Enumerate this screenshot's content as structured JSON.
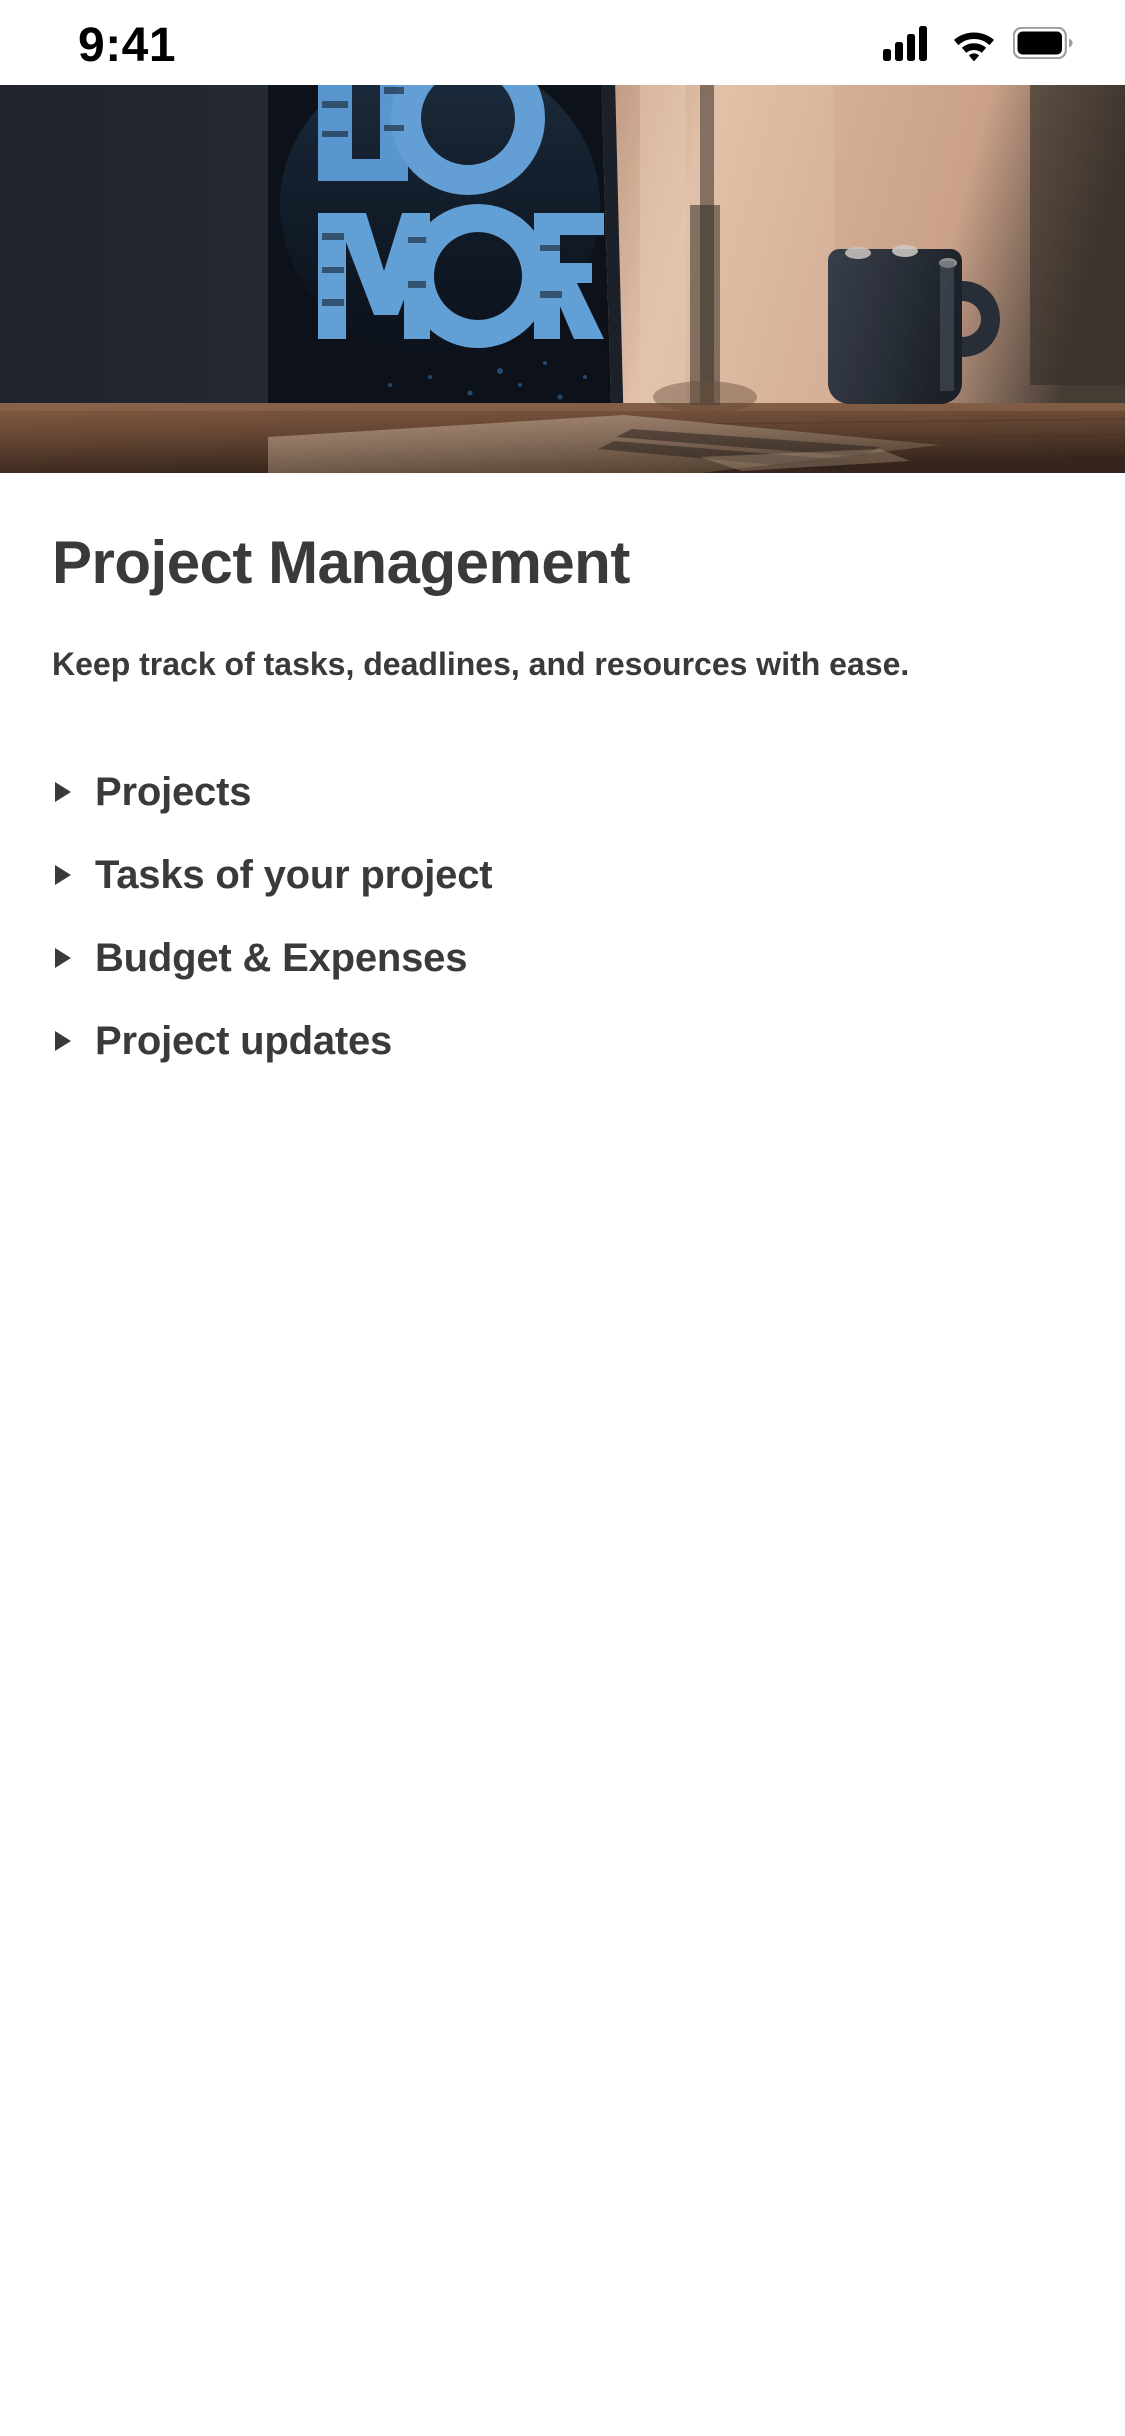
{
  "status_bar": {
    "time": "9:41",
    "icons": {
      "cellular": "cellular-signal-icon",
      "wifi": "wifi-icon",
      "battery": "battery-full-icon"
    }
  },
  "hero": {
    "alt": "laptop-on-desk-photo",
    "screen_text_line1": "DO",
    "screen_text_line2": "MORE.",
    "colors": {
      "wall_dark": "#2b313b",
      "screen_dark": "#10151d",
      "screen_glyph_blue": "#4b8fd4",
      "warm_light": "#e2b79b",
      "desk_wood": "#7a5540",
      "mug_dark": "#2e3440"
    }
  },
  "main": {
    "title": "Project Management",
    "subtitle": "Keep track of tasks, deadlines, and resources with ease.",
    "list": [
      {
        "label": "Projects",
        "bullet": "triangle-right-icon"
      },
      {
        "label": "Tasks of your project",
        "bullet": "triangle-right-icon"
      },
      {
        "label": "Budget & Expenses",
        "bullet": "triangle-right-icon"
      },
      {
        "label": "Project updates",
        "bullet": "triangle-right-icon"
      }
    ]
  },
  "theme": {
    "background": "#ffffff",
    "text_primary": "#3a3a38",
    "status_text": "#000000"
  }
}
